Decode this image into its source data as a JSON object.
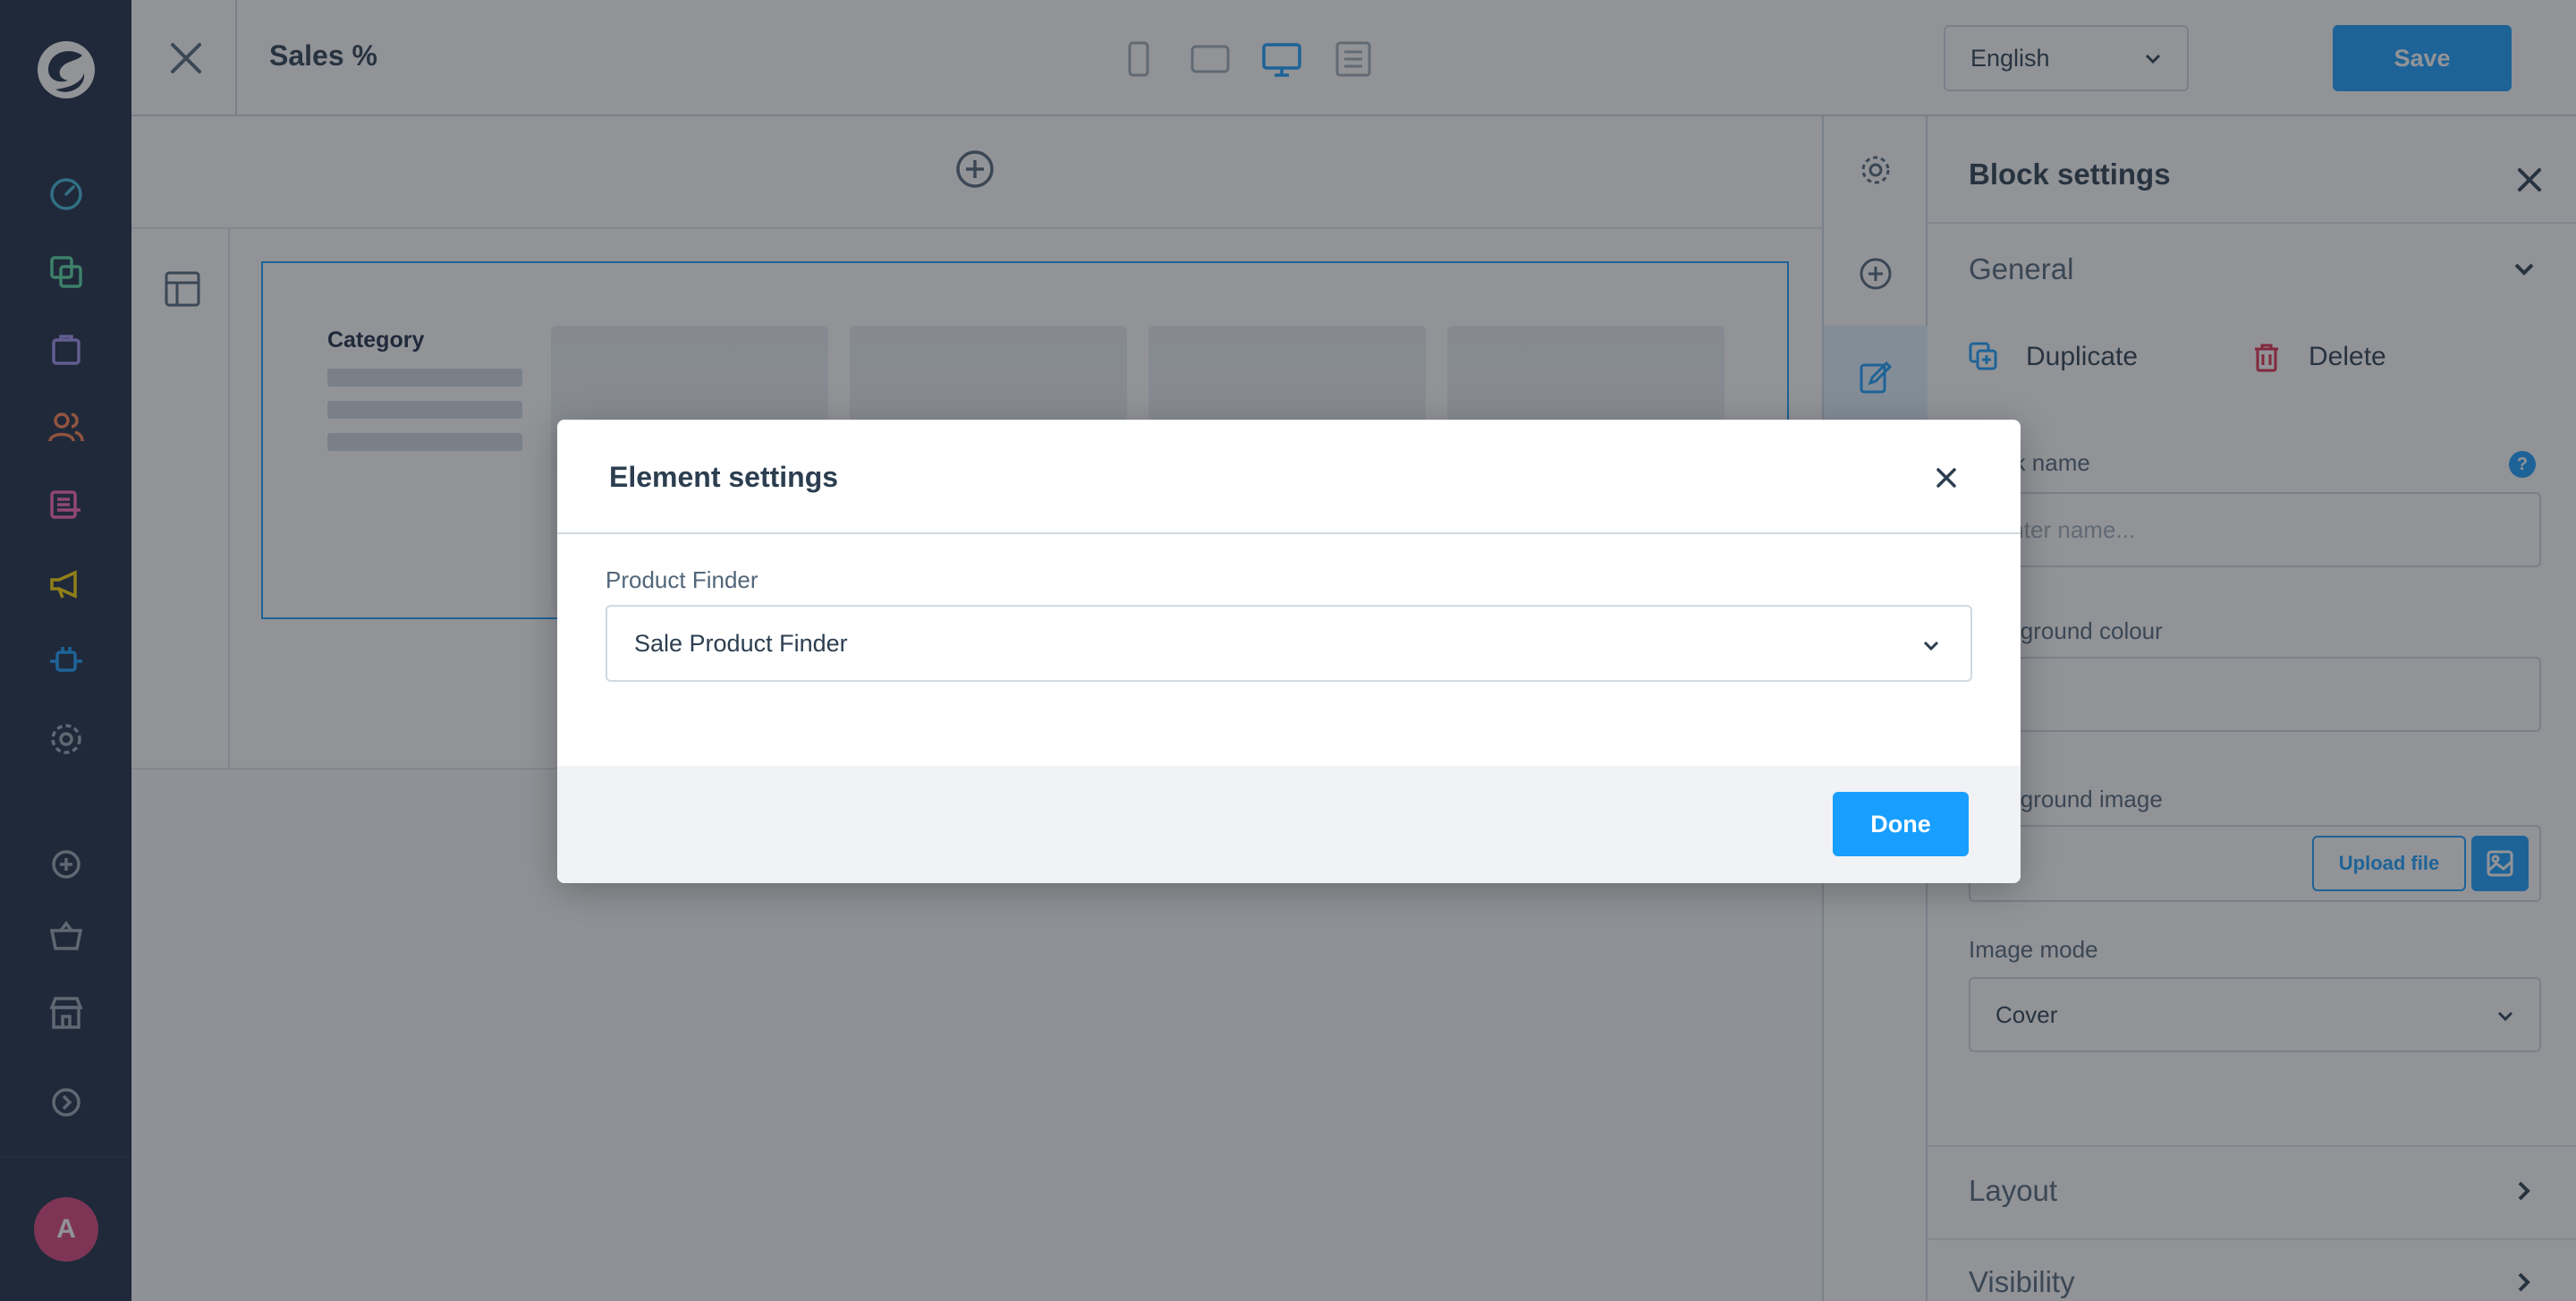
{
  "nav": {
    "icons": [
      "dashboard-icon",
      "catalogue-icon",
      "orders-icon",
      "customers-icon",
      "content-icon",
      "marketing-icon",
      "extensions-icon",
      "settings-icon",
      "add-icon",
      "basket-icon",
      "store-icon",
      "expand-icon"
    ],
    "avatar_initial": "A",
    "colors": {
      "bg": "#1a2a44",
      "dashboard": "#40b8d8",
      "catalogue": "#57d9a3",
      "orders": "#a092f0",
      "customers": "#ff7f50",
      "content": "#ff68b4",
      "marketing": "#ffd700",
      "extensions": "#189eff",
      "settings": "#9aa8b5"
    }
  },
  "topbar": {
    "title": "Sales %",
    "devices": [
      "mobile-icon",
      "tablet-icon",
      "desktop-icon",
      "list-icon"
    ],
    "language": "English",
    "save_label": "Save"
  },
  "canvas": {
    "block": {
      "category_label": "Category"
    }
  },
  "sidebar": {
    "title": "Block settings",
    "general_label": "General",
    "duplicate_label": "Duplicate",
    "delete_label": "Delete",
    "block_name_label": "Block name",
    "block_name_placeholder": "Enter name...",
    "background_colour_label": "Background colour",
    "background_image_label": "Background image",
    "upload_label": "Upload file",
    "image_mode_label": "Image mode",
    "image_mode_value": "Cover",
    "layout_label": "Layout",
    "visibility_label": "Visibility",
    "help_glyph": "?"
  },
  "modal": {
    "title": "Element settings",
    "field_label": "Product Finder",
    "field_value": "Sale Product Finder",
    "done_label": "Done"
  },
  "colors": {
    "accent": "#189eff",
    "delete": "#de294c"
  }
}
